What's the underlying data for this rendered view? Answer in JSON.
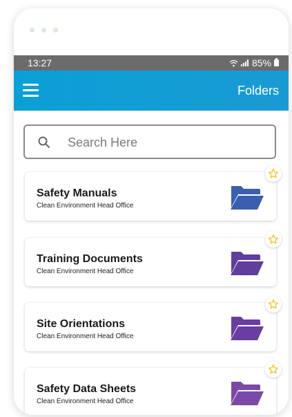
{
  "status": {
    "time": "13:27",
    "battery": "85%"
  },
  "appbar": {
    "title": "Folders"
  },
  "search": {
    "placeholder": "Search Here"
  },
  "folders": [
    {
      "name": "Safety Manuals",
      "subtitle": "Clean Environment Head Office",
      "color": "#3a5fae"
    },
    {
      "name": "Training Documents",
      "subtitle": "Clean Environment Head Office",
      "color": "#5f3e9e"
    },
    {
      "name": "Site Orientations",
      "subtitle": "Clean Environment Head Office",
      "color": "#6a3ea0"
    },
    {
      "name": "Safety Data Sheets",
      "subtitle": "Clean Environment Head Office",
      "color": "#7b4aa8"
    }
  ],
  "colors": {
    "appbar": "#0aa0d6",
    "star": "#f2c21b"
  }
}
